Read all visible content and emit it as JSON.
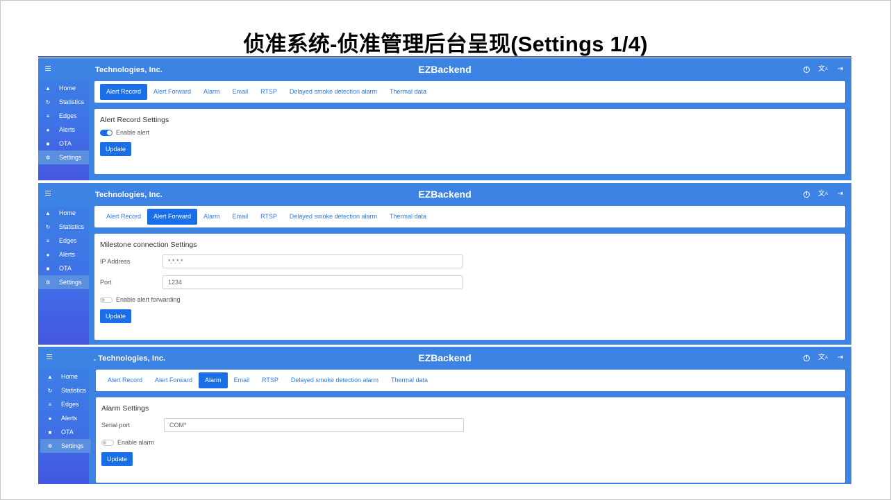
{
  "slide": {
    "title": "侦准系统-侦准管理后台呈现(Settings 1/4)"
  },
  "app": {
    "company": "Technologies, Inc.",
    "company_clipped": ". Technologies, Inc.",
    "name": "EZBackend"
  },
  "nav": {
    "home": "Home",
    "statistics": "Statistics",
    "edges": "Edges",
    "alerts": "Alerts",
    "ota": "OTA",
    "settings": "Settings"
  },
  "tabs": {
    "alert_record": "Alert Record",
    "alert_forward": "Alert Forward",
    "alarm": "Alarm",
    "email": "Email",
    "rtsp": "RTSP",
    "delayed_smoke": "Delayed smoke detection alarm",
    "thermal": "Thermal data"
  },
  "panel1": {
    "section_title": "Alert Record Settings",
    "toggle_label": "Enable alert",
    "toggle_on": true,
    "button": "Update"
  },
  "panel2": {
    "section_title": "Milestone connection Settings",
    "ip_label": "IP Address",
    "ip_value": "*.*.*.*",
    "port_label": "Port",
    "port_value": "1234",
    "toggle_label": "Enable alert forwarding",
    "toggle_on": false,
    "button": "Update"
  },
  "panel3": {
    "section_title": "Alarm Settings",
    "serial_label": "Serial port",
    "serial_value": "COM*",
    "toggle_label": "Enable alarm",
    "toggle_on": false,
    "button": "Update"
  },
  "colors": {
    "header_blue": "#3d83e3",
    "primary": "#1a6fe8",
    "active_nav": "#5a8fe0"
  },
  "icons": {
    "menu": "hamburger-menu-icon",
    "info": "info-icon",
    "translate": "translate-icon",
    "logout": "logout-icon"
  }
}
